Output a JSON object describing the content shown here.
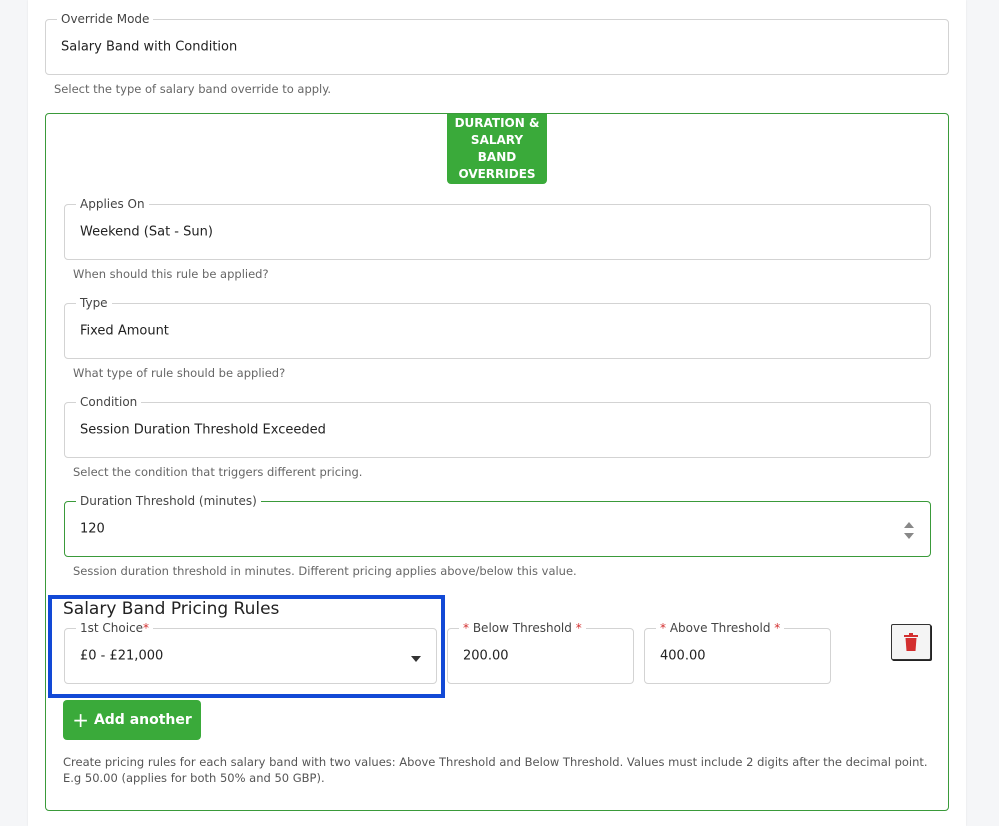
{
  "override_mode": {
    "label": "Override Mode",
    "value": "Salary Band with Condition",
    "help": "Select the type of salary band override to apply."
  },
  "panel": {
    "badge": "DURATION & SALARY BAND OVERRIDES",
    "applies_on": {
      "label": "Applies On",
      "value": "Weekend (Sat - Sun)",
      "help": "When should this rule be applied?"
    },
    "type": {
      "label": "Type",
      "value": "Fixed Amount",
      "help": "What type of rule should be applied?"
    },
    "condition": {
      "label": "Condition",
      "value": "Session Duration Threshold Exceeded",
      "help": "Select the condition that triggers different pricing."
    },
    "duration_threshold": {
      "label": "Duration Threshold (minutes)",
      "value": "120",
      "help": "Session duration threshold in minutes. Different pricing applies above/below this value."
    },
    "pricing_rules": {
      "title": "Salary Band Pricing Rules",
      "choice_label": "1st Choice",
      "choice_value": "£0 - £21,000",
      "below_label": "Below Threshold",
      "below_value": "200.00",
      "above_label": "Above Threshold",
      "above_value": "400.00",
      "required_mark": "*"
    },
    "add_button": {
      "icon": "+",
      "label": "Add another"
    },
    "footnote": "Create pricing rules for each salary band with two values: Above Threshold and Below Threshold. Values must include 2 digits after the decimal point. E.g 50.00 (applies for both 50% and 50 GBP)."
  },
  "colors": {
    "accent_green": "#3aaa3a",
    "highlight_blue": "#1249d6",
    "trash_red": "#d32f2f"
  },
  "icons": {
    "trash": "trash-icon",
    "dropdown": "chevron-down-icon",
    "spinner": "spinner-icon",
    "add": "plus-icon"
  }
}
